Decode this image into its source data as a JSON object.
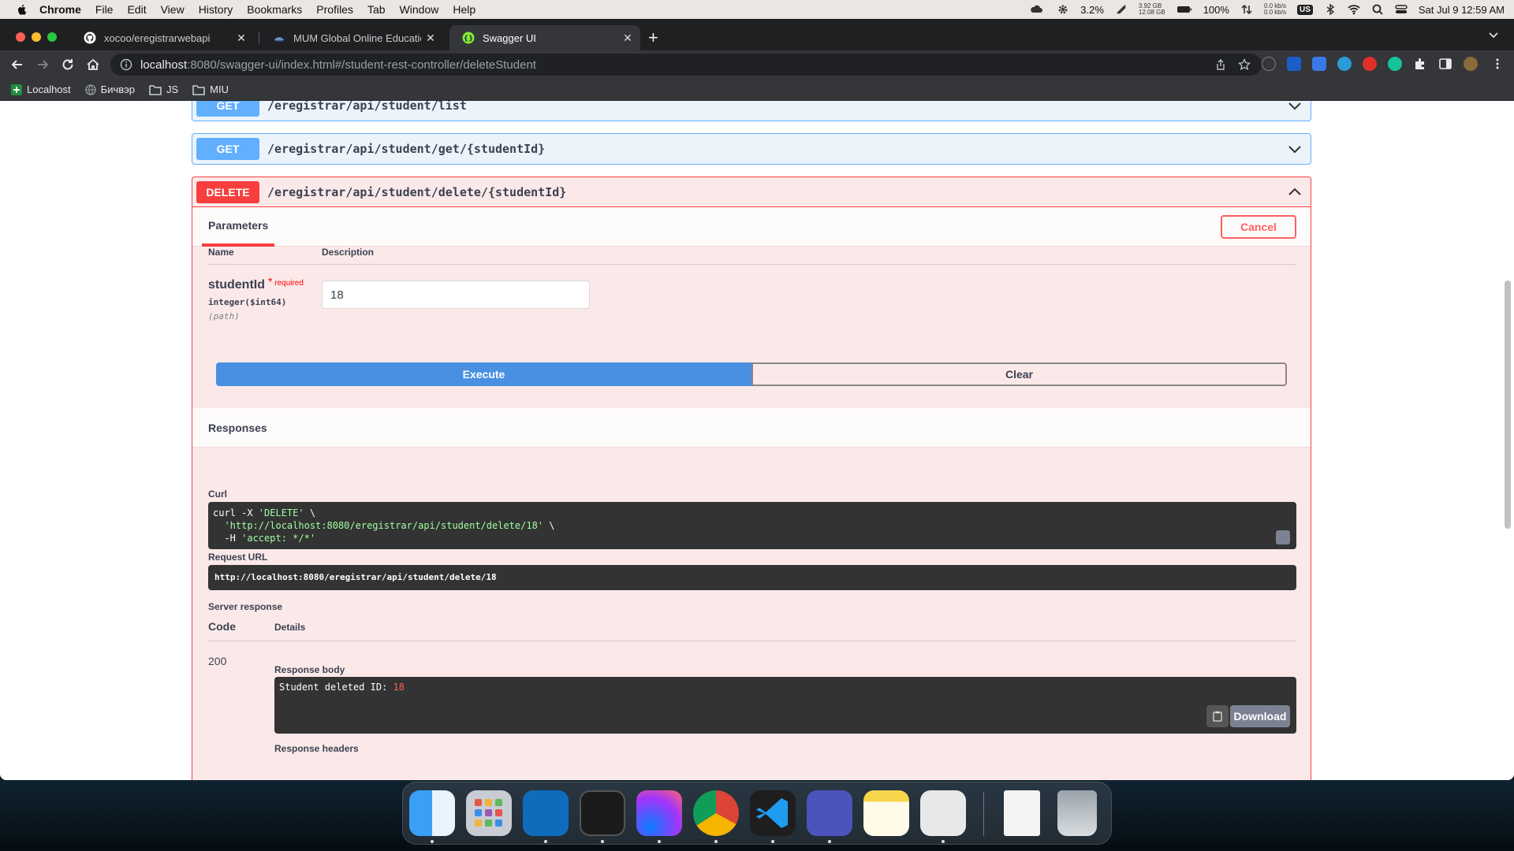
{
  "menubar": {
    "items": [
      "Chrome",
      "File",
      "Edit",
      "View",
      "History",
      "Bookmarks",
      "Profiles",
      "Tab",
      "Window",
      "Help"
    ],
    "cpu": "3.2%",
    "mem_top": "3.92 GB",
    "mem_bottom": "12.08 GB",
    "battery": "100%",
    "net_top": "0.0 kb/s",
    "net_bottom": "0.0 kb/s",
    "input_source": "US",
    "datetime": "Sat Jul 9  12:59 AM"
  },
  "tabs": [
    {
      "title": "xocoo/eregistrarwebapi",
      "icon": "github-icon"
    },
    {
      "title": "MUM Global Online Education",
      "icon": "mum-icon"
    },
    {
      "title": "Swagger UI",
      "icon": "swagger-icon"
    }
  ],
  "address": {
    "host": "localhost",
    "path": ":8080/swagger-ui/index.html#/student-rest-controller/deleteStudent"
  },
  "bookmarks": [
    {
      "label": "Localhost",
      "icon": "localhost-icon"
    },
    {
      "label": "Бичвэр",
      "icon": "globe-icon"
    },
    {
      "label": "JS",
      "icon": "folder-icon"
    },
    {
      "label": "MIU",
      "icon": "folder-icon"
    }
  ],
  "operations": {
    "list": {
      "method": "GET",
      "path": "/eregistrar/api/student/list"
    },
    "get": {
      "method": "GET",
      "path": "/eregistrar/api/student/get/{studentId}"
    },
    "delete": {
      "method": "DELETE",
      "path": "/eregistrar/api/student/delete/{studentId}"
    }
  },
  "delete_panel": {
    "params_tab": "Parameters",
    "cancel": "Cancel",
    "col_name": "Name",
    "col_desc": "Description",
    "param_name": "studentId",
    "required_mark": "*",
    "required": "required",
    "param_type": "integer($int64)",
    "param_in": "(path)",
    "param_value": "18",
    "execute": "Execute",
    "clear": "Clear",
    "responses_title": "Responses",
    "curl_label": "Curl",
    "curl_line1_a": "curl -X ",
    "curl_line1_b": "'DELETE'",
    "curl_line1_c": " \\",
    "curl_line2_a": "  ",
    "curl_line2_b": "'http://localhost:8080/eregistrar/api/student/delete/18'",
    "curl_line2_c": " \\",
    "curl_line3_a": "  -H ",
    "curl_line3_b": "'accept: */*'",
    "request_url_label": "Request URL",
    "request_url": "http://localhost:8080/eregistrar/api/student/delete/18",
    "server_response_label": "Server response",
    "code_header": "Code",
    "details_header": "Details",
    "code": "200",
    "response_body_label": "Response body",
    "response_body_text": "Student deleted ID: ",
    "response_body_num": "18",
    "download": "Download",
    "response_headers_label": "Response headers"
  },
  "dock": [
    "finder-icon",
    "launchpad-icon",
    "outlook-icon",
    "terminal-icon",
    "messenger-icon",
    "chrome-icon",
    "vscode-icon",
    "teams-icon",
    "notes-icon",
    "cheatengine-icon",
    "document-icon",
    "trash-icon"
  ]
}
